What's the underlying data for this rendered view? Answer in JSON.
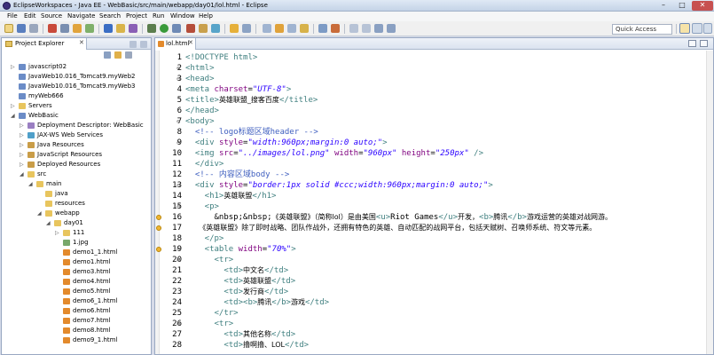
{
  "window": {
    "title": "EclipseWorkspaces - Java EE - WebBasic/src/main/webapp/day01/lol.html - Eclipse",
    "minimize": "–",
    "maximize": "□",
    "close": "✕"
  },
  "menu": [
    "File",
    "Edit",
    "Source",
    "Navigate",
    "Search",
    "Project",
    "Run",
    "Window",
    "Help"
  ],
  "quick_access": "Quick Access",
  "explorer": {
    "tab_label": "Project Explorer",
    "tab_close": "✕",
    "tree": [
      {
        "label": "javascript02",
        "depth": 0,
        "arrow": "▷",
        "icon": "project"
      },
      {
        "label": "JavaWeb10.016_Tomcat9.myWeb2",
        "depth": 0,
        "arrow": "",
        "icon": "project"
      },
      {
        "label": "JavaWeb10.016_Tomcat9.myWeb3",
        "depth": 0,
        "arrow": "",
        "icon": "project"
      },
      {
        "label": "myWeb666",
        "depth": 0,
        "arrow": "",
        "icon": "project"
      },
      {
        "label": "Servers",
        "depth": 0,
        "arrow": "▷",
        "icon": "folder"
      },
      {
        "label": "WebBasic",
        "depth": 0,
        "arrow": "◢",
        "icon": "project"
      },
      {
        "label": "Deployment Descriptor: WebBasic",
        "depth": 1,
        "arrow": "▷",
        "icon": "descriptor"
      },
      {
        "label": "JAX-WS Web Services",
        "depth": 1,
        "arrow": "▷",
        "icon": "service"
      },
      {
        "label": "Java Resources",
        "depth": 1,
        "arrow": "▷",
        "icon": "package"
      },
      {
        "label": "JavaScript Resources",
        "depth": 1,
        "arrow": "▷",
        "icon": "package"
      },
      {
        "label": "Deployed Resources",
        "depth": 1,
        "arrow": "▷",
        "icon": "package"
      },
      {
        "label": "src",
        "depth": 1,
        "arrow": "◢",
        "icon": "folder"
      },
      {
        "label": "main",
        "depth": 2,
        "arrow": "◢",
        "icon": "folder"
      },
      {
        "label": "java",
        "depth": 3,
        "arrow": "",
        "icon": "folder"
      },
      {
        "label": "resources",
        "depth": 3,
        "arrow": "",
        "icon": "folder"
      },
      {
        "label": "webapp",
        "depth": 3,
        "arrow": "◢",
        "icon": "folder"
      },
      {
        "label": "day01",
        "depth": 4,
        "arrow": "◢",
        "icon": "folder"
      },
      {
        "label": "111",
        "depth": 5,
        "arrow": "▷",
        "icon": "folder"
      },
      {
        "label": "1.jpg",
        "depth": 5,
        "arrow": "",
        "icon": "image"
      },
      {
        "label": "demo1_1.html",
        "depth": 5,
        "arrow": "",
        "icon": "html"
      },
      {
        "label": "demo1.html",
        "depth": 5,
        "arrow": "",
        "icon": "html"
      },
      {
        "label": "demo3.html",
        "depth": 5,
        "arrow": "",
        "icon": "html"
      },
      {
        "label": "demo4.html",
        "depth": 5,
        "arrow": "",
        "icon": "html"
      },
      {
        "label": "demo5.html",
        "depth": 5,
        "arrow": "",
        "icon": "html"
      },
      {
        "label": "demo6_1.html",
        "depth": 5,
        "arrow": "",
        "icon": "html"
      },
      {
        "label": "demo6.html",
        "depth": 5,
        "arrow": "",
        "icon": "html"
      },
      {
        "label": "demo7.html",
        "depth": 5,
        "arrow": "",
        "icon": "html"
      },
      {
        "label": "demo8.html",
        "depth": 5,
        "arrow": "",
        "icon": "html"
      },
      {
        "label": "demo9_1.html",
        "depth": 5,
        "arrow": "",
        "icon": "html"
      }
    ]
  },
  "editor": {
    "tab_label": "lol.html",
    "tab_close": "✕",
    "lines": [
      {
        "n": "1",
        "fold": "",
        "warn": false,
        "segs": [
          [
            "t",
            "<!DOCTYPE html>"
          ]
        ]
      },
      {
        "n": "2",
        "fold": "⊖",
        "warn": false,
        "segs": [
          [
            "t",
            "<html>"
          ]
        ]
      },
      {
        "n": "3",
        "fold": "⊖",
        "warn": false,
        "segs": [
          [
            "t",
            "<head>"
          ]
        ]
      },
      {
        "n": "4",
        "fold": "",
        "warn": false,
        "segs": [
          [
            "t",
            "<meta "
          ],
          [
            "a",
            "charset"
          ],
          [
            "x",
            "="
          ],
          [
            "v",
            "\"UTF-8\""
          ],
          [
            "t",
            ">"
          ]
        ]
      },
      {
        "n": "5",
        "fold": "",
        "warn": false,
        "segs": [
          [
            "t",
            "<title>"
          ],
          [
            "cjk",
            "英雄联盟_搜客百度"
          ],
          [
            "t",
            "</title>"
          ]
        ]
      },
      {
        "n": "6",
        "fold": "",
        "warn": false,
        "segs": [
          [
            "t",
            "</head>"
          ]
        ]
      },
      {
        "n": "7",
        "fold": "⊖",
        "warn": false,
        "segs": [
          [
            "t",
            "<body>"
          ]
        ]
      },
      {
        "n": "8",
        "fold": "",
        "warn": false,
        "segs": [
          [
            "c",
            "  <!-- logo标题区域header -->"
          ]
        ]
      },
      {
        "n": "9",
        "fold": "⊖",
        "warn": false,
        "segs": [
          [
            "t",
            "  <div "
          ],
          [
            "a",
            "style"
          ],
          [
            "x",
            "="
          ],
          [
            "v",
            "\"width:960px;margin:0 auto;\""
          ],
          [
            "t",
            ">"
          ]
        ]
      },
      {
        "n": "10",
        "fold": "",
        "warn": false,
        "segs": [
          [
            "t",
            "  <img "
          ],
          [
            "a",
            "src"
          ],
          [
            "x",
            "="
          ],
          [
            "v",
            "\"../images/lol.png\""
          ],
          [
            "t",
            " "
          ],
          [
            "a",
            "width"
          ],
          [
            "x",
            "="
          ],
          [
            "v",
            "\"960px\""
          ],
          [
            "t",
            " "
          ],
          [
            "a",
            "height"
          ],
          [
            "x",
            "="
          ],
          [
            "v",
            "\"250px\""
          ],
          [
            "t",
            " />"
          ]
        ]
      },
      {
        "n": "11",
        "fold": "",
        "warn": false,
        "segs": [
          [
            "t",
            "  </div>"
          ]
        ]
      },
      {
        "n": "12",
        "fold": "",
        "warn": false,
        "segs": [
          [
            "c",
            "  <!-- 内容区域body -->"
          ]
        ]
      },
      {
        "n": "13",
        "fold": "⊖",
        "warn": false,
        "segs": [
          [
            "t",
            "  <div "
          ],
          [
            "a",
            "style"
          ],
          [
            "x",
            "="
          ],
          [
            "v",
            "\"border:1px solid #ccc;width:960px;margin:0 auto;\""
          ],
          [
            "t",
            ">"
          ]
        ]
      },
      {
        "n": "14",
        "fold": "",
        "warn": false,
        "segs": [
          [
            "t",
            "    <h1>"
          ],
          [
            "cjk",
            "英雄联盟"
          ],
          [
            "t",
            "</h1>"
          ]
        ]
      },
      {
        "n": "15",
        "fold": "⊖",
        "warn": false,
        "segs": [
          [
            "t",
            "    <p>"
          ]
        ]
      },
      {
        "n": "16",
        "fold": "",
        "warn": true,
        "segs": [
          [
            "x",
            "      &nbsp;&nbsp;"
          ],
          [
            "cjk",
            "《英雄联盟》（简称lol）是由美国"
          ],
          [
            "t",
            "<u>"
          ],
          [
            "x",
            "Riot Games"
          ],
          [
            "t",
            "</u>"
          ],
          [
            "cjk",
            "开发，"
          ],
          [
            "t",
            "<b>"
          ],
          [
            "cjk",
            "腾讯"
          ],
          [
            "t",
            "</b>"
          ],
          [
            "cjk",
            "游戏运营的英雄对战网游。"
          ]
        ]
      },
      {
        "n": "17",
        "fold": "",
        "warn": true,
        "segs": [
          [
            "cjk",
            "      《英雄联盟》除了即时战略、团队作战外，还拥有特色的英雄、自动匹配的战网平台，包括天赋树、召唤师系统、符文等元素。"
          ]
        ]
      },
      {
        "n": "18",
        "fold": "",
        "warn": false,
        "segs": [
          [
            "t",
            "    </p>"
          ]
        ]
      },
      {
        "n": "19",
        "fold": "⊖",
        "warn": true,
        "segs": [
          [
            "t",
            "    <table "
          ],
          [
            "a",
            "width"
          ],
          [
            "x",
            "="
          ],
          [
            "v",
            "\"70%\""
          ],
          [
            "t",
            ">"
          ]
        ]
      },
      {
        "n": "20",
        "fold": "⊖",
        "warn": false,
        "segs": [
          [
            "t",
            "      <tr>"
          ]
        ]
      },
      {
        "n": "21",
        "fold": "",
        "warn": false,
        "segs": [
          [
            "t",
            "        <td>"
          ],
          [
            "cjk",
            "中文名"
          ],
          [
            "t",
            "</td>"
          ]
        ]
      },
      {
        "n": "22",
        "fold": "",
        "warn": false,
        "segs": [
          [
            "t",
            "        <td>"
          ],
          [
            "cjk",
            "英雄联盟"
          ],
          [
            "t",
            "</td>"
          ]
        ]
      },
      {
        "n": "23",
        "fold": "",
        "warn": false,
        "segs": [
          [
            "t",
            "        <td>"
          ],
          [
            "cjk",
            "发行商"
          ],
          [
            "t",
            "</td>"
          ]
        ]
      },
      {
        "n": "24",
        "fold": "",
        "warn": false,
        "segs": [
          [
            "t",
            "        <td><b>"
          ],
          [
            "cjk",
            "腾讯"
          ],
          [
            "t",
            "</b>"
          ],
          [
            "cjk",
            "游戏"
          ],
          [
            "t",
            "</td>"
          ]
        ]
      },
      {
        "n": "25",
        "fold": "",
        "warn": false,
        "segs": [
          [
            "t",
            "      </tr>"
          ]
        ]
      },
      {
        "n": "26",
        "fold": "⊖",
        "warn": false,
        "segs": [
          [
            "t",
            "      <tr>"
          ]
        ]
      },
      {
        "n": "27",
        "fold": "",
        "warn": false,
        "segs": [
          [
            "t",
            "        <td>"
          ],
          [
            "cjk",
            "其他名称"
          ],
          [
            "t",
            "</td>"
          ]
        ]
      },
      {
        "n": "28",
        "fold": "",
        "warn": false,
        "segs": [
          [
            "t",
            "        <td>"
          ],
          [
            "cjk",
            "撸啊撸、LOL"
          ],
          [
            "t",
            "</td>"
          ]
        ]
      }
    ]
  }
}
